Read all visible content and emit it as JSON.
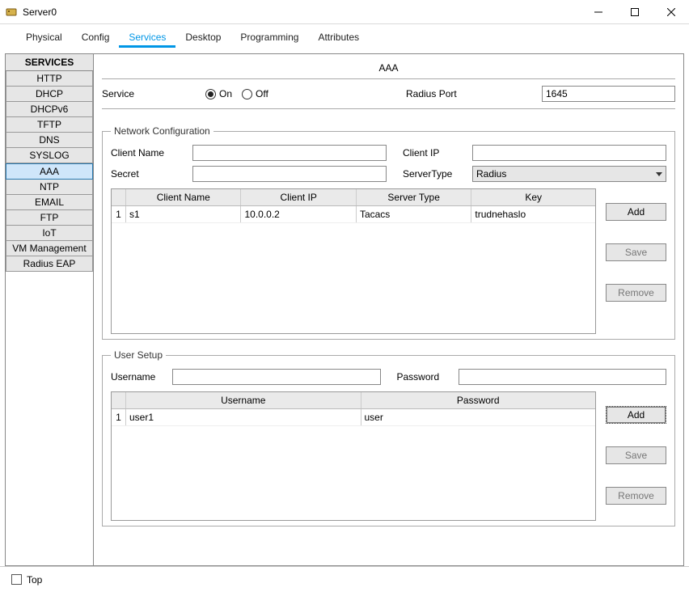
{
  "window": {
    "title": "Server0"
  },
  "tabs": [
    "Physical",
    "Config",
    "Services",
    "Desktop",
    "Programming",
    "Attributes"
  ],
  "active_tab": "Services",
  "sidebar": {
    "header": "SERVICES",
    "items": [
      "HTTP",
      "DHCP",
      "DHCPv6",
      "TFTP",
      "DNS",
      "SYSLOG",
      "AAA",
      "NTP",
      "EMAIL",
      "FTP",
      "IoT",
      "VM Management",
      "Radius EAP"
    ],
    "selected": "AAA"
  },
  "page": {
    "title": "AAA"
  },
  "service": {
    "label": "Service",
    "on_label": "On",
    "off_label": "Off",
    "state": "On",
    "port_label": "Radius Port",
    "port_value": "1645"
  },
  "netcfg": {
    "legend": "Network Configuration",
    "client_name_label": "Client Name",
    "client_name_value": "",
    "client_ip_label": "Client IP",
    "client_ip_value": "",
    "secret_label": "Secret",
    "secret_value": "",
    "servertype_label": "ServerType",
    "servertype_value": "Radius",
    "columns": [
      "Client Name",
      "Client IP",
      "Server Type",
      "Key"
    ],
    "rows": [
      {
        "n": "1",
        "client_name": "s1",
        "client_ip": "10.0.0.2",
        "server_type": "Tacacs",
        "key": "trudnehaslo"
      }
    ],
    "buttons": {
      "add": "Add",
      "save": "Save",
      "remove": "Remove"
    }
  },
  "usersetup": {
    "legend": "User Setup",
    "username_label": "Username",
    "username_value": "",
    "password_label": "Password",
    "password_value": "",
    "columns": [
      "Username",
      "Password"
    ],
    "rows": [
      {
        "n": "1",
        "username": "user1",
        "password": "user"
      }
    ],
    "buttons": {
      "add": "Add",
      "save": "Save",
      "remove": "Remove"
    }
  },
  "footer": {
    "top_label": "Top"
  }
}
